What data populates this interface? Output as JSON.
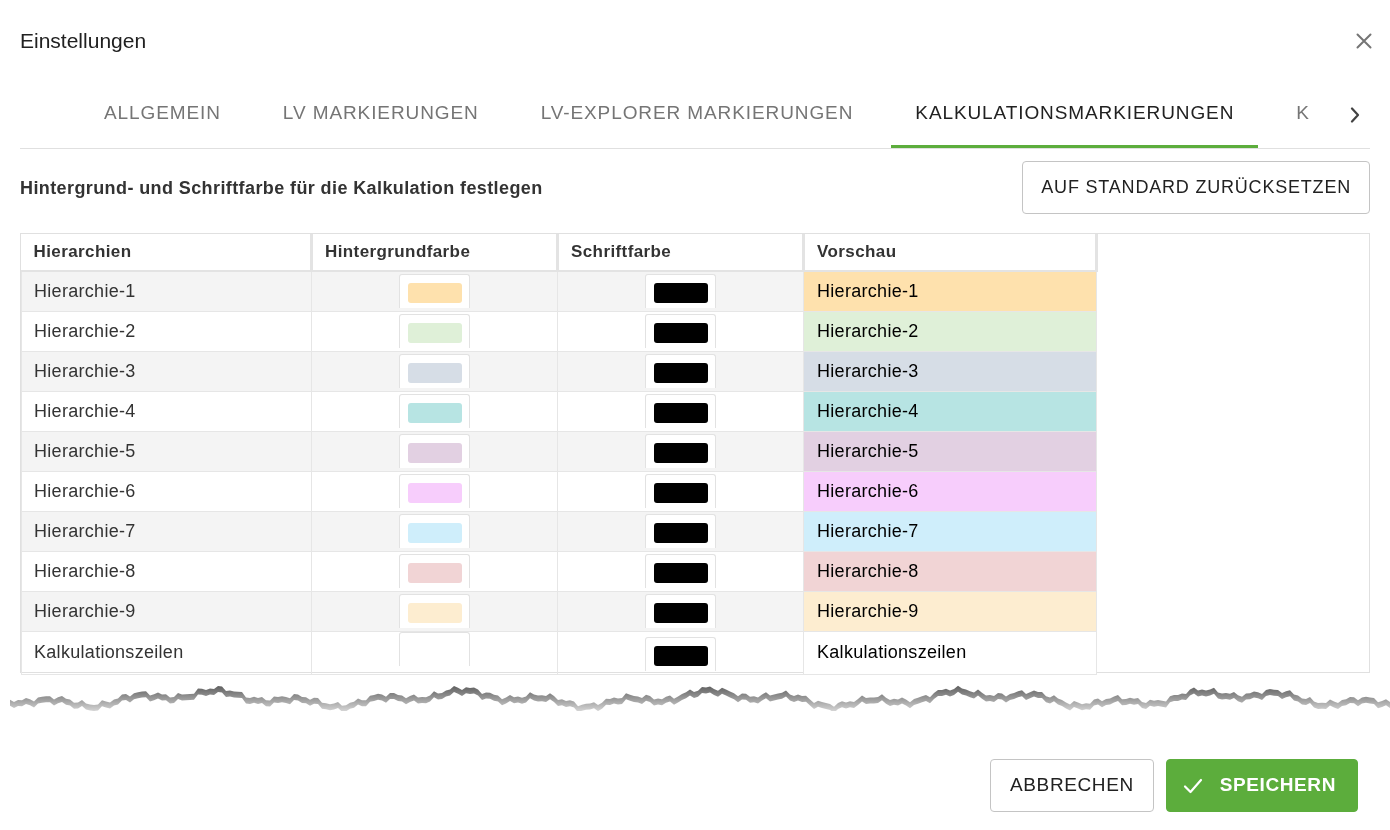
{
  "dialog": {
    "title": "Einstellungen"
  },
  "tabs": [
    {
      "label": "ALLGEMEIN",
      "selected": false
    },
    {
      "label": "LV MARKIERUNGEN",
      "selected": false
    },
    {
      "label": "LV-EXPLORER MARKIERUNGEN",
      "selected": false
    },
    {
      "label": "KALKULATIONSMARKIERUNGEN",
      "selected": true
    },
    {
      "label": "K",
      "selected": false
    }
  ],
  "description": "Hintergrund- und Schriftfarbe für die Kalkulation festlegen",
  "reset_button": "AUF STANDARD ZURÜCKSETZEN",
  "table": {
    "columns": [
      "Hierarchien",
      "Hintergrundfarbe",
      "Schriftfarbe",
      "Vorschau"
    ],
    "rows": [
      {
        "name": "Hierarchie-1",
        "background": {
          "color": "#fee1ad"
        },
        "font": {
          "color": "#000000"
        },
        "preview": "Hierarchie-1"
      },
      {
        "name": "Hierarchie-2",
        "background": {
          "color": "#dff0d8"
        },
        "font": {
          "color": "#000000"
        },
        "preview": "Hierarchie-2"
      },
      {
        "name": "Hierarchie-3",
        "background": {
          "color": "#d6dde6"
        },
        "font": {
          "color": "#000000"
        },
        "preview": "Hierarchie-3"
      },
      {
        "name": "Hierarchie-4",
        "background": {
          "color": "#b7e4e3"
        },
        "font": {
          "color": "#000000"
        },
        "preview": "Hierarchie-4"
      },
      {
        "name": "Hierarchie-5",
        "background": {
          "color": "#e2d0e2"
        },
        "font": {
          "color": "#000000"
        },
        "preview": "Hierarchie-5"
      },
      {
        "name": "Hierarchie-6",
        "background": {
          "color": "#f7cdfc"
        },
        "font": {
          "color": "#000000"
        },
        "preview": "Hierarchie-6"
      },
      {
        "name": "Hierarchie-7",
        "background": {
          "color": "#cfeefb"
        },
        "font": {
          "color": "#000000"
        },
        "preview": "Hierarchie-7"
      },
      {
        "name": "Hierarchie-8",
        "background": {
          "color": "#f1d4d5"
        },
        "font": {
          "color": "#000000"
        },
        "preview": "Hierarchie-8"
      },
      {
        "name": "Hierarchie-9",
        "background": {
          "color": "#fdedd0"
        },
        "font": {
          "color": "#000000"
        },
        "preview": "Hierarchie-9"
      },
      {
        "name": "Kalkulationszeilen",
        "font": {
          "color": "#000000"
        },
        "preview": "Kalkulationszeilen"
      }
    ]
  },
  "buttons": [
    {
      "label": "ABBRECHEN",
      "kind": "secondary"
    },
    {
      "label": "SPEICHERN",
      "kind": "primary"
    }
  ]
}
